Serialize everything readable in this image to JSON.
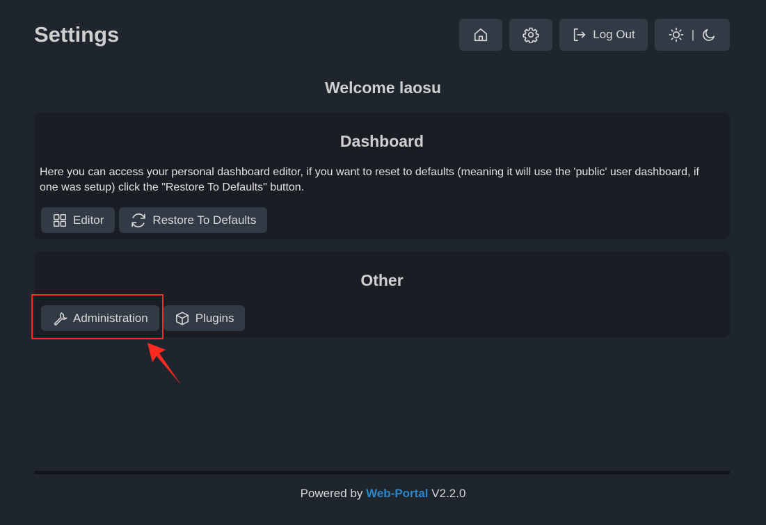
{
  "page": {
    "title": "Settings"
  },
  "topbar": {
    "home_icon": "home-icon",
    "settings_icon": "gear-icon",
    "logout_label": "Log Out",
    "logout_icon": "logout-icon",
    "theme_separator": "|",
    "light_icon": "sun-icon",
    "dark_icon": "moon-icon"
  },
  "welcome": {
    "text": "Welcome laosu"
  },
  "dashboard_section": {
    "title": "Dashboard",
    "description": "Here you can access your personal dashboard editor, if you want to reset to defaults (meaning it will use the 'public' user dashboard, if one was setup) click the \"Restore To Defaults\" button.",
    "editor_label": "Editor",
    "editor_icon": "grid-icon",
    "restore_label": "Restore To Defaults",
    "restore_icon": "refresh-icon"
  },
  "other_section": {
    "title": "Other",
    "administration_label": "Administration",
    "administration_icon": "wrench-icon",
    "plugins_label": "Plugins",
    "plugins_icon": "box-icon"
  },
  "annotation": {
    "highlight_color": "#ff2a1f"
  },
  "footer": {
    "prefix": "Powered by",
    "brand": "Web-Portal",
    "version": "V2.2.0",
    "brand_color": "#2f86c6"
  },
  "colors": {
    "background": "#1f252d",
    "card": "#1a1e24",
    "button": "#323a45"
  }
}
